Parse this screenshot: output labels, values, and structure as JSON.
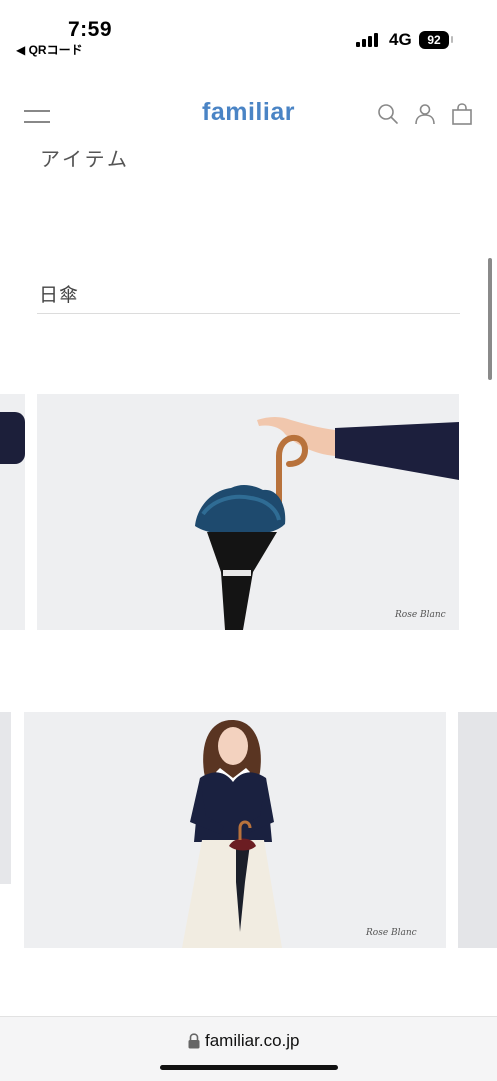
{
  "status": {
    "time": "7:59",
    "back_label": "◀ QRコード",
    "network": "4G",
    "battery": "92"
  },
  "header": {
    "logo": "familiar",
    "icons": [
      "menu-icon",
      "search-icon",
      "user-icon",
      "bag-icon"
    ],
    "brand_color": "#4a84c5"
  },
  "content": {
    "section_title": "アイテム",
    "category": "日傘",
    "brand_watermark": "Rose Blanc"
  },
  "browser": {
    "url": "familiar.co.jp"
  }
}
